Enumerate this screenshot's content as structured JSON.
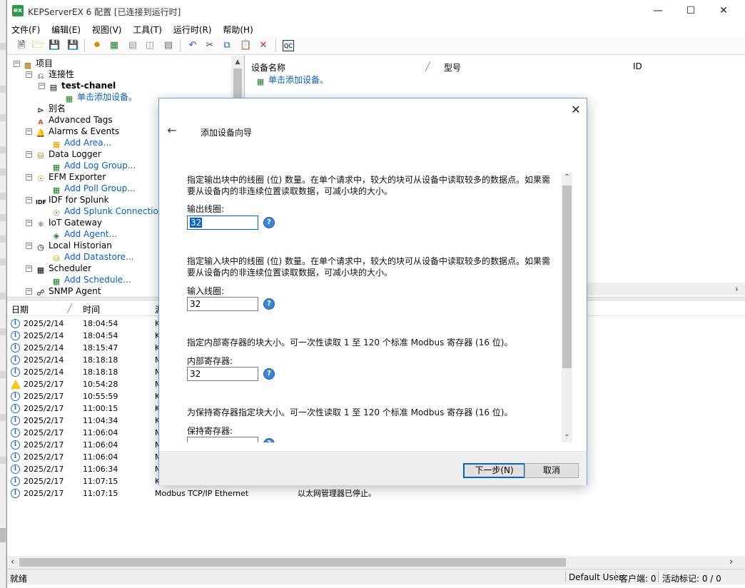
{
  "window": {
    "app_icon": "ex",
    "title": "KEPServerEX 6 配置 [已连接到运行时]",
    "min_icon": "minimize-icon",
    "max_icon": "maximize-icon",
    "close_icon": "close-icon"
  },
  "menu": [
    "文件(F)",
    "编辑(E)",
    "视图(V)",
    "工具(T)",
    "运行时(R)",
    "帮助(H)"
  ],
  "tree": {
    "root": "项目",
    "connectivity": "连接性",
    "channel": "test-chanel",
    "add_device": "单击添加设备。",
    "aliases": "别名",
    "advanced_tags": "Advanced Tags",
    "alarms": "Alarms & Events",
    "add_area": "Add Area...",
    "data_logger": "Data Logger",
    "add_log_group": "Add Log Group...",
    "efm": "EFM Exporter",
    "add_poll_group": "Add Poll Group...",
    "idf": "IDF for Splunk",
    "add_splunk": "Add Splunk Connection...",
    "iot": "IoT Gateway",
    "add_agent": "Add Agent...",
    "historian": "Local Historian",
    "add_datastore": "Add Datastore...",
    "scheduler": "Scheduler",
    "add_schedule": "Add Schedule...",
    "snmp": "SNMP Agent"
  },
  "device_list": {
    "col_name": "设备名称",
    "col_model": "型号",
    "col_id": "ID",
    "add_device": "单击添加设备。"
  },
  "log": {
    "col_date": "日期",
    "col_time": "时间",
    "col_source": "源",
    "rows": [
      {
        "icon": "info",
        "date": "2025/2/14",
        "time": "18:04:54",
        "src": "K",
        "msg": ""
      },
      {
        "icon": "info",
        "date": "2025/2/14",
        "time": "18:04:54",
        "src": "K",
        "msg": ""
      },
      {
        "icon": "info",
        "date": "2025/2/14",
        "time": "18:15:47",
        "src": "K",
        "msg": ""
      },
      {
        "icon": "info",
        "date": "2025/2/14",
        "time": "18:18:18",
        "src": "M",
        "msg": ""
      },
      {
        "icon": "info",
        "date": "2025/2/14",
        "time": "18:18:18",
        "src": "M",
        "msg": ""
      },
      {
        "icon": "warn",
        "date": "2025/2/17",
        "time": "10:54:28",
        "src": "M",
        "msg": ""
      },
      {
        "icon": "info",
        "date": "2025/2/17",
        "time": "10:55:59",
        "src": "K",
        "msg": ""
      },
      {
        "icon": "info",
        "date": "2025/2/17",
        "time": "11:00:15",
        "src": "K",
        "msg": ""
      },
      {
        "icon": "info",
        "date": "2025/2/17",
        "time": "11:04:34",
        "src": "K",
        "msg": ""
      },
      {
        "icon": "info",
        "date": "2025/2/17",
        "time": "11:06:04",
        "src": "M",
        "msg": ""
      },
      {
        "icon": "info",
        "date": "2025/2/17",
        "time": "11:06:04",
        "src": "M",
        "msg": ""
      },
      {
        "icon": "info",
        "date": "2025/2/17",
        "time": "11:06:04",
        "src": "M",
        "msg": ""
      },
      {
        "icon": "info",
        "date": "2025/2/17",
        "time": "11:06:34",
        "src": "M",
        "msg": ""
      },
      {
        "icon": "info",
        "date": "2025/2/17",
        "time": "11:07:15",
        "src": "K",
        "msg": ""
      },
      {
        "icon": "info",
        "date": "2025/2/17",
        "time": "11:07:15",
        "src": "Modbus TCP/IP Ethernet",
        "msg": "以太网管理器已停止。"
      }
    ]
  },
  "status": {
    "ready": "就绪",
    "user": "Default User",
    "clients": "客户端: 0",
    "active_tags": "活动标记: 0 / 0"
  },
  "dialog": {
    "title": "添加设备向导",
    "back_icon": "back-arrow-icon",
    "close_icon": "close-icon",
    "desc_output_coils": "指定输出块中的线圈 (位) 数量。在单个请求中，较大的块可从设备中读取较多的数据点。如果需要从设备内的非连续位置读取数据，可减小块的大小。",
    "label_output_coils": "输出线圈:",
    "value_output_coils": "32",
    "desc_input_coils": "指定输入块中的线圈 (位) 数量。在单个请求中，较大的块可从设备中读取较多的数据点。如果需要从设备内的非连续位置读取数据，可减小块的大小。",
    "label_input_coils": "输入线圈:",
    "value_input_coils": "32",
    "desc_internal_regs": "指定内部寄存器的块大小。可一次性读取 1 至 120 个标准 Modbus 寄存器 (16 位)。",
    "label_internal_regs": "内部寄存器:",
    "value_internal_regs": "32",
    "desc_holding_regs": "为保持寄存器指定块大小。可一次性读取 1 至 120 个标准 Modbus 寄存器 (16 位)。",
    "label_holding_regs": "保持寄存器:",
    "next_button": "下一步(N)",
    "cancel_button": "取消"
  }
}
